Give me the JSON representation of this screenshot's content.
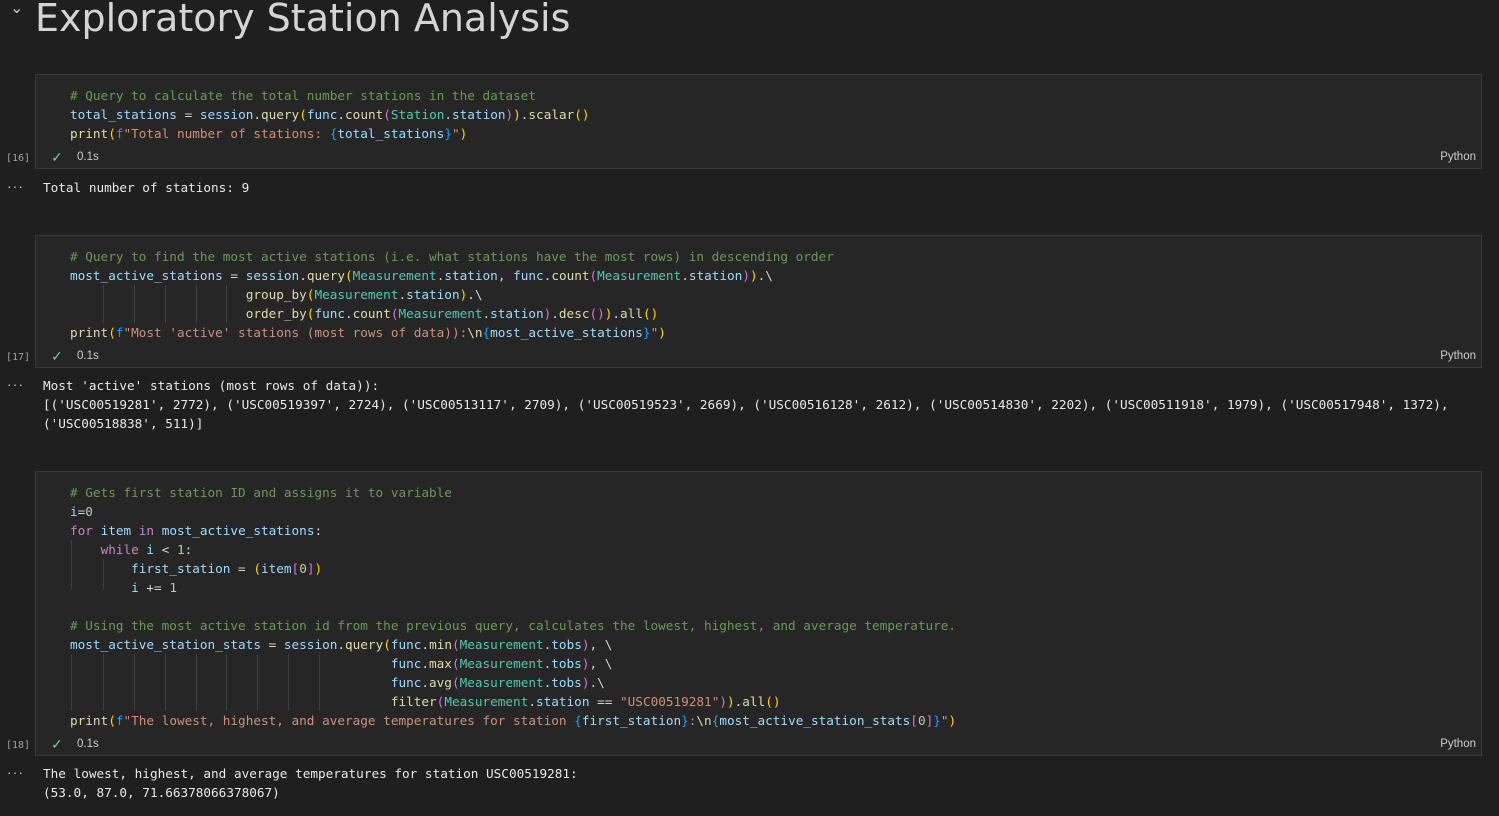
{
  "notebook": {
    "heading": "Exploratory Station Analysis"
  },
  "cells": [
    {
      "exec_count": "[16]",
      "duration": "0.1s",
      "language": "Python",
      "code_lines": [
        "# Query to calculate the total number stations in the dataset",
        "total_stations = session.query(func.count(Station.station)).scalar()",
        "print(f\"Total number of stations: {total_stations}\")"
      ],
      "output_lines": [
        "Total number of stations: 9"
      ]
    },
    {
      "exec_count": "[17]",
      "duration": "0.1s",
      "language": "Python",
      "code_lines": [
        "# Query to find the most active stations (i.e. what stations have the most rows) in descending order",
        "most_active_stations = session.query(Measurement.station, func.count(Measurement.station)).\\",
        "                       group_by(Measurement.station).\\",
        "                       order_by(func.count(Measurement.station).desc()).all()",
        "print(f\"Most 'active' stations (most rows of data)):\\n{most_active_stations}\")"
      ],
      "output_lines": [
        "Most 'active' stations (most rows of data)):",
        "[('USC00519281', 2772), ('USC00519397', 2724), ('USC00513117', 2709), ('USC00519523', 2669), ('USC00516128', 2612), ('USC00514830', 2202), ('USC00511918', 1979), ('USC00517948', 1372),",
        "('USC00518838', 511)]"
      ]
    },
    {
      "exec_count": "[18]",
      "duration": "0.1s",
      "language": "Python",
      "code_lines": [
        "# Gets first station ID and assigns it to variable",
        "i=0",
        "for item in most_active_stations:",
        "    while i < 1:",
        "        first_station = (item[0])",
        "        i += 1",
        "",
        "# Using the most active station id from the previous query, calculates the lowest, highest, and average temperature.",
        "most_active_station_stats = session.query(func.min(Measurement.tobs), \\",
        "                                          func.max(Measurement.tobs), \\",
        "                                          func.avg(Measurement.tobs).\\",
        "                                          filter(Measurement.station == \"USC00519281\")).all()",
        "print(f\"The lowest, highest, and average temperatures for station {first_station}:\\n{most_active_station_stats[0]}\")"
      ],
      "output_lines": [
        "The lowest, highest, and average temperatures for station USC00519281:",
        "(53.0, 87.0, 71.66378066378067)"
      ]
    }
  ],
  "icons": {
    "collapse": "chevron-down-icon",
    "success": "check-icon",
    "output_menu": "more-icon"
  },
  "colors": {
    "background": "#1f1f1f",
    "cell_background": "#262626",
    "check": "#73c991",
    "comment": "#6a9955",
    "variable": "#9cdcfe",
    "function": "#dcdcaa",
    "string": "#ce9178",
    "keyword": "#c586c0"
  }
}
